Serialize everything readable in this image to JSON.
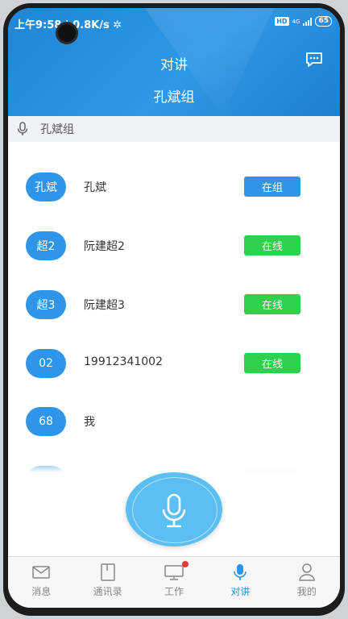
{
  "status_bar": {
    "time_speed": "上午9:58 | 0.8K/s ✲",
    "hd": "HD",
    "network": "4G",
    "battery": "65"
  },
  "header": {
    "title": "对讲",
    "group_name": "孔斌组",
    "chat_icon": "chat-bubble-icon"
  },
  "search": {
    "text": "孔斌组",
    "icon": "microphone-icon"
  },
  "members": [
    {
      "avatar": "孔斌",
      "name": "孔斌",
      "status": "在组",
      "status_color": "#2e95e8"
    },
    {
      "avatar": "超2",
      "name": "阮建超2",
      "status": "在线",
      "status_color": "#2fd04c"
    },
    {
      "avatar": "超3",
      "name": "阮建超3",
      "status": "在线",
      "status_color": "#2fd04c"
    },
    {
      "avatar": "02",
      "name": "19912341002",
      "status": "在线",
      "status_color": "#2fd04c"
    },
    {
      "avatar": "68",
      "name": "我",
      "status": "",
      "status_color": ""
    }
  ],
  "ptt_button": {
    "icon": "microphone-icon",
    "color": "#5bbff3"
  },
  "tabs": [
    {
      "label": "消息",
      "icon": "mail-icon",
      "active": false
    },
    {
      "label": "通讯录",
      "icon": "contacts-book-icon",
      "active": false
    },
    {
      "label": "工作",
      "icon": "monitor-icon",
      "active": false,
      "notification_dot": true
    },
    {
      "label": "对讲",
      "icon": "microphone-icon",
      "active": true
    },
    {
      "label": "我的",
      "icon": "person-icon",
      "active": false
    }
  ],
  "colors": {
    "accent": "#2e95e8",
    "online": "#2fd04c",
    "header": "#1f86d8"
  }
}
